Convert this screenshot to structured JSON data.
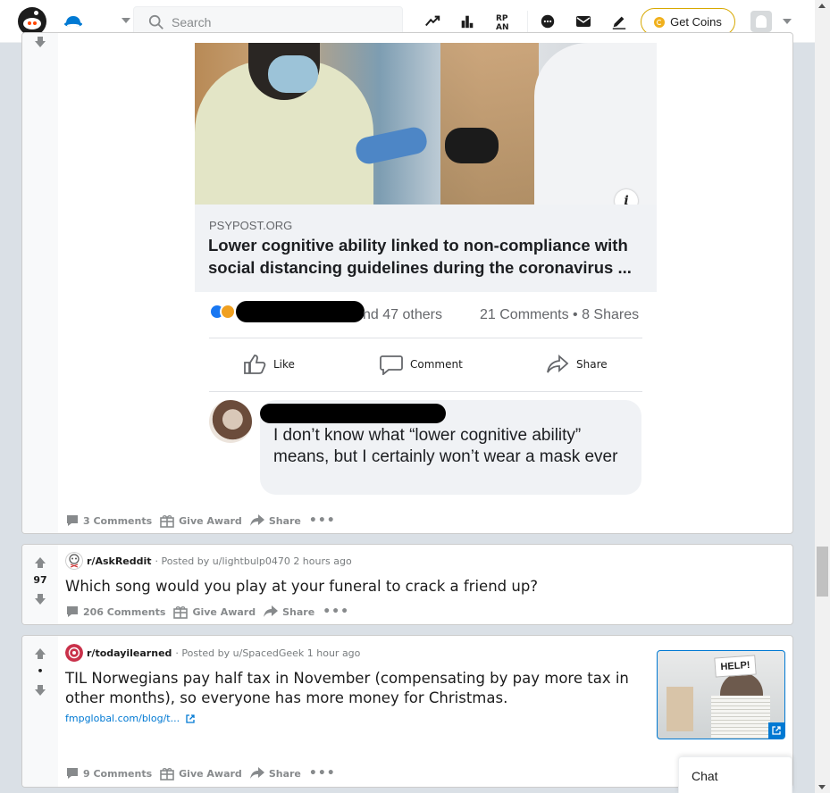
{
  "header": {
    "search_placeholder": "Search",
    "get_coins_label": "Get Coins",
    "icons": [
      "reddit-logo",
      "home-icon",
      "trending-icon",
      "stats-icon",
      "rpan-icon",
      "chat-icon",
      "mail-icon",
      "pencil-icon",
      "user-avatar"
    ]
  },
  "post1": {
    "image": {
      "source": "PSYPOST.ORG",
      "headline": "Lower cognitive ability linked to non-compliance with social distancing guidelines during the coronavirus ...",
      "reactions_suffix": "nd 47 others",
      "counts": "21 Comments • 8 Shares",
      "like_label": "Like",
      "comment_label": "Comment",
      "share_label": "Share",
      "comment_text": "I don’t know what “lower cognitive ability” means, but I certainly won’t wear a mask ever"
    },
    "actions": {
      "comments": "3 Comments",
      "give_award": "Give Award",
      "share": "Share"
    }
  },
  "post2": {
    "score": "97",
    "subreddit": "r/AskReddit",
    "posted_by": "· Posted by u/lightbulp0470 2 hours ago",
    "title": "Which song would you play at your funeral to crack a friend up?",
    "actions": {
      "comments": "206 Comments",
      "give_award": "Give Award",
      "share": "Share"
    }
  },
  "post3": {
    "score": "•",
    "subreddit": "r/todayilearned",
    "posted_by": "· Posted by u/SpacedGeek 1 hour ago",
    "title": "TIL Norwegians pay half tax in November (compensating by pay more tax in other months), so everyone has more money for Christmas.",
    "link": "fmpglobal.com/blog/t...",
    "thumb_sign": "HELP!",
    "actions": {
      "comments": "9 Comments",
      "give_award": "Give Award",
      "share": "Share"
    }
  },
  "chat": {
    "label": "Chat"
  },
  "colors": {
    "accent": "#0079d3",
    "upvote": "#878a8c",
    "coin": "#f0b01c"
  }
}
